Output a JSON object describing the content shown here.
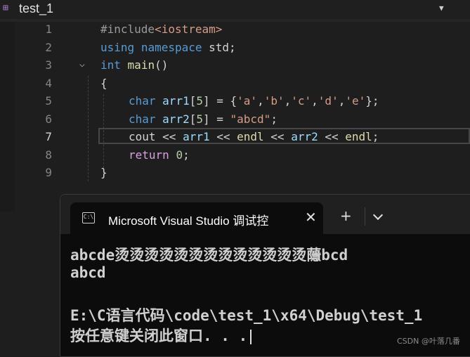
{
  "window": {
    "file_tab": "test_1",
    "dropdown_icon": "chevron-down-icon"
  },
  "editor": {
    "line_numbers": [
      "1",
      "2",
      "3",
      "4",
      "5",
      "6",
      "7",
      "8",
      "9"
    ],
    "active_line": "7",
    "lines": {
      "l1_directive": "#include",
      "l1_header": "<iostream>",
      "l2_using": "using",
      "l2_namespace": "namespace",
      "l2_std": "std;",
      "l3_int": "int",
      "l3_main": "main",
      "l3_parens": "()",
      "l4_brace": "{",
      "l5_char": "char",
      "l5_var": "arr1",
      "l5_rest_a": "[",
      "l5_size": "5",
      "l5_rest_b": "] = {",
      "l5_a": "'a'",
      "l5_b": "'b'",
      "l5_c": "'c'",
      "l5_d": "'d'",
      "l5_e": "'e'",
      "l5_comma": ",",
      "l5_end": "};",
      "l6_char": "char",
      "l6_var": "arr2",
      "l6_rest_a": "[",
      "l6_size": "5",
      "l6_rest_b": "] = ",
      "l6_str": "\"abcd\"",
      "l6_end": ";",
      "l7_cout": "cout",
      "l7_op": " << ",
      "l7_arr1": "arr1",
      "l7_endl": "endl",
      "l7_arr2": "arr2",
      "l7_end": ";",
      "l8_return": "return",
      "l8_zero": "0",
      "l8_end": ";",
      "l9_brace": "}"
    }
  },
  "terminal": {
    "tab_title": "Microsoft Visual Studio 调试控",
    "tab_icon_text": "C:\\",
    "close_glyph": "✕",
    "new_tab_glyph": "+",
    "output": [
      "abcde烫烫烫烫烫烫烫烫烫烫烫烫烫蘟bcd",
      "abcd",
      "",
      "E:\\C语言代码\\code\\test_1\\x64\\Debug\\test_1",
      "按任意键关闭此窗口. . ."
    ]
  },
  "watermark": "CSDN @叶落几番"
}
